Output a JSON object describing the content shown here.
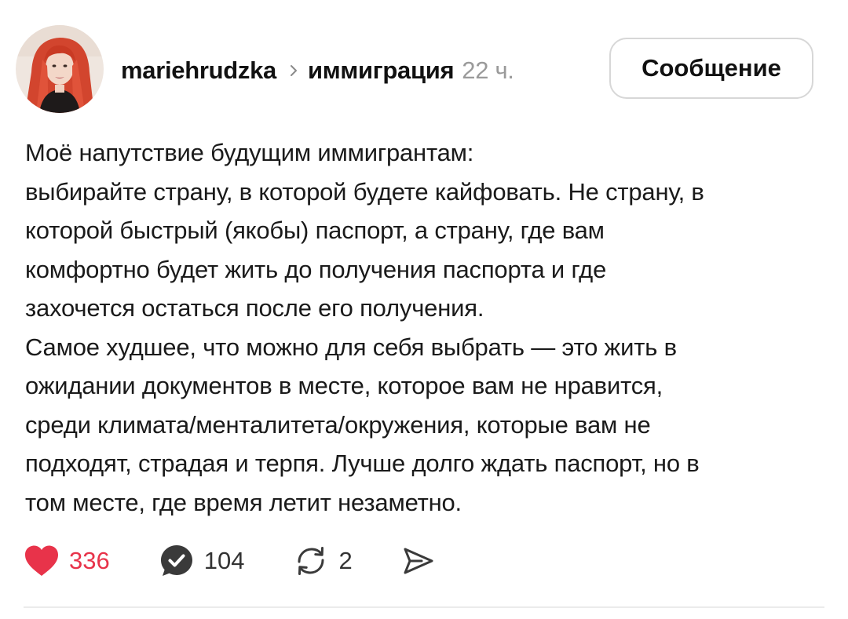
{
  "post": {
    "author": {
      "username": "mariehrudzka",
      "avatar_icon": "user-avatar-photo"
    },
    "community": "иммиграция",
    "time": "22 ч.",
    "message_button_label": "Сообщение",
    "body_lines": [
      "Моё напутствие будущим иммигрантам:",
      "выбирайте страну, в которой будете кайфовать. Не страну, в",
      "которой быстрый (якобы) паспорт, а страну, где вам",
      "комфортно будет жить до получения паспорта и где",
      "захочется остаться после его получения.",
      "Самое худшее, что можно для себя выбрать — это жить в",
      "ожидании документов в месте, которое вам не нравится,",
      "среди климата/менталитета/окружения, которые вам не",
      "подходят, страдая и терпя. Лучше долго ждать паспорт, но в",
      "том месте, где время летит незаметно."
    ],
    "actions": {
      "likes": "336",
      "comments": "104",
      "reposts": "2"
    },
    "colors": {
      "like": "#e8334a",
      "text": "#1a1a1a",
      "muted": "#9a9a9a",
      "icon_dark": "#3a3a3a"
    }
  }
}
